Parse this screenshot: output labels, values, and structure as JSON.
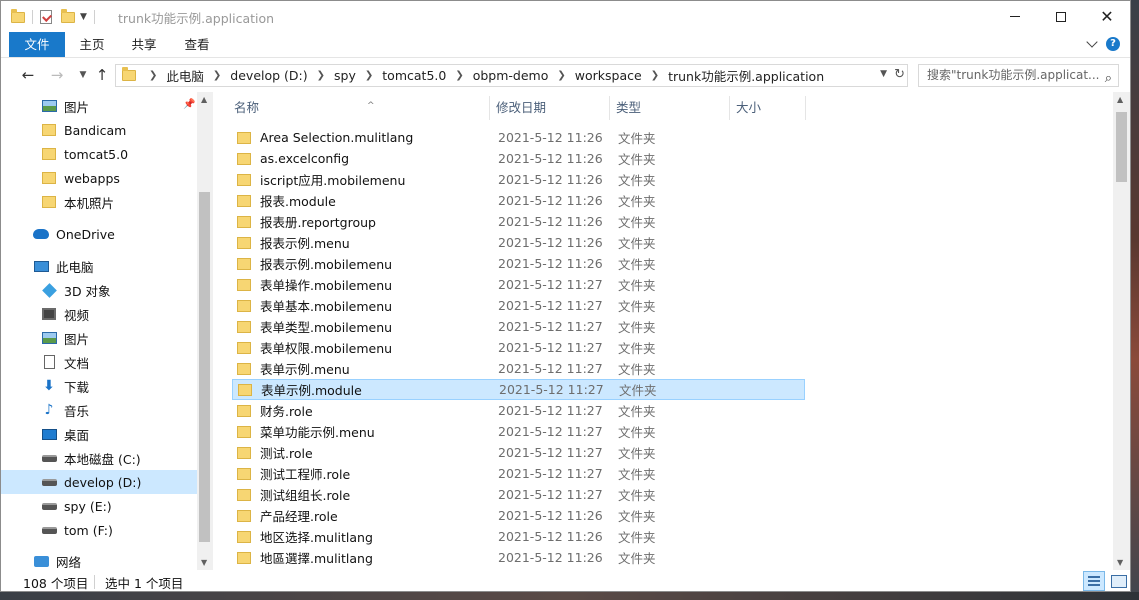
{
  "window": {
    "title": "trunk功能示例.application"
  },
  "ribbon": {
    "tabs": [
      "文件",
      "主页",
      "共享",
      "查看"
    ]
  },
  "address": {
    "crumbs": [
      "此电脑",
      "develop (D:)",
      "spy",
      "tomcat5.0",
      "obpm-demo",
      "workspace",
      "trunk功能示例.application"
    ],
    "search_placeholder": "搜索\"trunk功能示例.applicat..."
  },
  "sidebar": {
    "items": [
      {
        "label": "图片",
        "icon": "pictures-icon"
      },
      {
        "label": "Bandicam",
        "icon": "folder-icon"
      },
      {
        "label": "tomcat5.0",
        "icon": "folder-icon"
      },
      {
        "label": "webapps",
        "icon": "folder-icon"
      },
      {
        "label": "本机照片",
        "icon": "folder-icon"
      },
      {
        "label": "OneDrive",
        "icon": "onedrive-icon"
      },
      {
        "label": "此电脑",
        "icon": "this-pc-icon"
      },
      {
        "label": "3D 对象",
        "icon": "3d-objects-icon"
      },
      {
        "label": "视频",
        "icon": "videos-icon"
      },
      {
        "label": "图片",
        "icon": "pictures-icon"
      },
      {
        "label": "文档",
        "icon": "documents-icon"
      },
      {
        "label": "下载",
        "icon": "downloads-icon"
      },
      {
        "label": "音乐",
        "icon": "music-icon"
      },
      {
        "label": "桌面",
        "icon": "desktop-icon"
      },
      {
        "label": "本地磁盘 (C:)",
        "icon": "drive-icon"
      },
      {
        "label": "develop (D:)",
        "icon": "drive-icon"
      },
      {
        "label": "spy (E:)",
        "icon": "drive-icon"
      },
      {
        "label": "tom (F:)",
        "icon": "drive-icon"
      },
      {
        "label": "网络",
        "icon": "network-icon"
      }
    ]
  },
  "columns": {
    "name": "名称",
    "date": "修改日期",
    "type": "类型",
    "size": "大小"
  },
  "files": [
    {
      "name": "Area Selection.mulitlang",
      "date": "2021-5-12 11:26",
      "type": "文件夹"
    },
    {
      "name": "as.excelconfig",
      "date": "2021-5-12 11:26",
      "type": "文件夹"
    },
    {
      "name": "iscript应用.mobilemenu",
      "date": "2021-5-12 11:26",
      "type": "文件夹"
    },
    {
      "name": "报表.module",
      "date": "2021-5-12 11:26",
      "type": "文件夹"
    },
    {
      "name": "报表册.reportgroup",
      "date": "2021-5-12 11:26",
      "type": "文件夹"
    },
    {
      "name": "报表示例.menu",
      "date": "2021-5-12 11:26",
      "type": "文件夹"
    },
    {
      "name": "报表示例.mobilemenu",
      "date": "2021-5-12 11:26",
      "type": "文件夹"
    },
    {
      "name": "表单操作.mobilemenu",
      "date": "2021-5-12 11:27",
      "type": "文件夹"
    },
    {
      "name": "表单基本.mobilemenu",
      "date": "2021-5-12 11:27",
      "type": "文件夹"
    },
    {
      "name": "表单类型.mobilemenu",
      "date": "2021-5-12 11:27",
      "type": "文件夹"
    },
    {
      "name": "表单权限.mobilemenu",
      "date": "2021-5-12 11:27",
      "type": "文件夹"
    },
    {
      "name": "表单示例.menu",
      "date": "2021-5-12 11:27",
      "type": "文件夹"
    },
    {
      "name": "表单示例.module",
      "date": "2021-5-12 11:27",
      "type": "文件夹"
    },
    {
      "name": "财务.role",
      "date": "2021-5-12 11:27",
      "type": "文件夹"
    },
    {
      "name": "菜单功能示例.menu",
      "date": "2021-5-12 11:27",
      "type": "文件夹"
    },
    {
      "name": "测试.role",
      "date": "2021-5-12 11:27",
      "type": "文件夹"
    },
    {
      "name": "测试工程师.role",
      "date": "2021-5-12 11:27",
      "type": "文件夹"
    },
    {
      "name": "测试组组长.role",
      "date": "2021-5-12 11:27",
      "type": "文件夹"
    },
    {
      "name": "产品经理.role",
      "date": "2021-5-12 11:26",
      "type": "文件夹"
    },
    {
      "name": "地区选择.mulitlang",
      "date": "2021-5-12 11:26",
      "type": "文件夹"
    },
    {
      "name": "地區選擇.mulitlang",
      "date": "2021-5-12 11:26",
      "type": "文件夹"
    }
  ],
  "status": {
    "count": "108 个项目",
    "selected": "选中 1 个项目"
  },
  "colors": {
    "accent": "#1979ca",
    "selection": "#cce8ff",
    "folder": "#f7d673"
  }
}
